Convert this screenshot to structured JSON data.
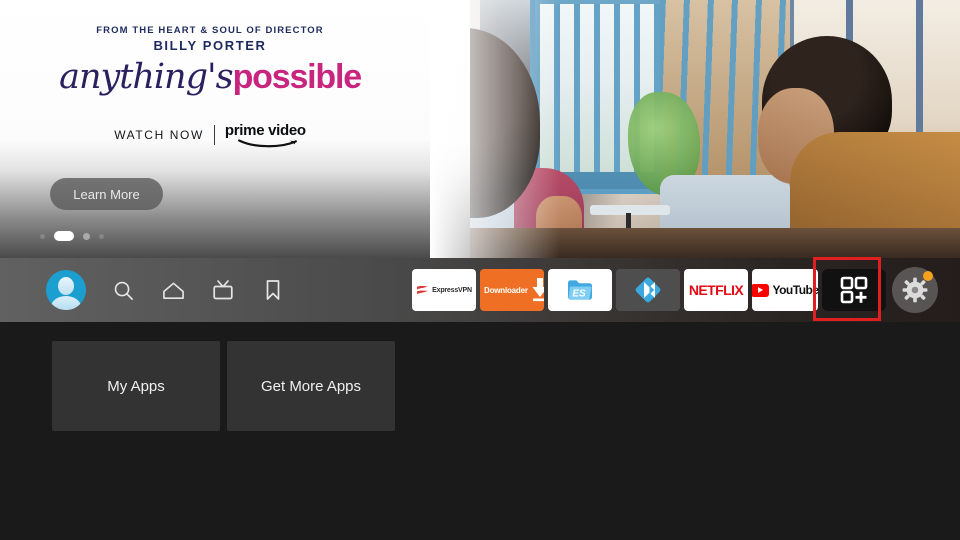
{
  "hero": {
    "kicker": "FROM THE HEART & SOUL OF DIRECTOR",
    "director": "BILLY PORTER",
    "title_script": "anything's",
    "title_bold": "possible",
    "watch_now": "WATCH NOW",
    "provider": "prime video",
    "cta_label": "Learn More",
    "pagination": {
      "count": 4,
      "active_index": 1
    },
    "colors": {
      "navy": "#1d2a5c",
      "magenta": "#c8257f",
      "script": "#2b2160"
    }
  },
  "nav": {
    "items": [
      {
        "name": "profile",
        "icon": "avatar-icon",
        "label": "Profile"
      },
      {
        "name": "search",
        "icon": "search-icon",
        "label": "Search"
      },
      {
        "name": "home",
        "icon": "home-icon",
        "label": "Home"
      },
      {
        "name": "live",
        "icon": "tv-icon",
        "label": "Live TV"
      },
      {
        "name": "bookmark",
        "icon": "bookmark-icon",
        "label": "Your Videos"
      }
    ]
  },
  "apps": {
    "items": [
      {
        "name": "expressvpn",
        "label": "ExpressVPN",
        "selected": false
      },
      {
        "name": "downloader",
        "label": "Downloader",
        "selected": false
      },
      {
        "name": "es-file-explorer",
        "label": "ES File Explorer",
        "selected": false
      },
      {
        "name": "kodi",
        "label": "Kodi",
        "selected": false
      },
      {
        "name": "netflix",
        "label": "NETFLIX",
        "selected": false
      },
      {
        "name": "youtube",
        "label": "YouTube",
        "selected": false
      },
      {
        "name": "app-grid",
        "label": "Apps",
        "selected": true
      }
    ],
    "settings": {
      "label": "Settings",
      "icon": "gear-icon",
      "badge": true,
      "badge_color": "#f5a11b"
    },
    "selection_color": "#e02020"
  },
  "content": {
    "tiles": [
      {
        "label": "My Apps"
      },
      {
        "label": "Get More Apps"
      }
    ]
  }
}
